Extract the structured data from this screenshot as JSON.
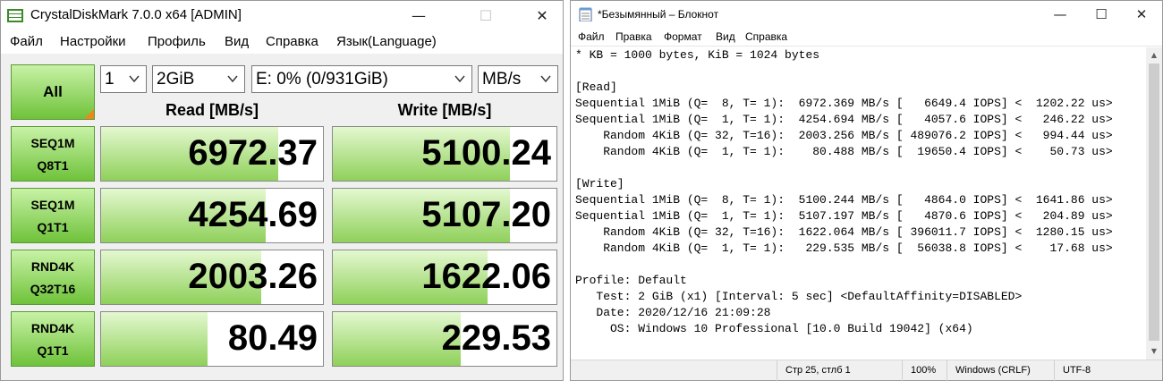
{
  "cdm": {
    "title": "CrystalDiskMark 7.0.0 x64 [ADMIN]",
    "menu": [
      "Файл",
      "Настройки",
      "Профиль",
      "Вид",
      "Справка",
      "Язык(Language)"
    ],
    "all_button": "All",
    "count": "1",
    "size": "2GiB",
    "drive": "E: 0% (0/931GiB)",
    "unit": "MB/s",
    "read_header": "Read [MB/s]",
    "write_header": "Write [MB/s]",
    "rows": [
      {
        "line1": "SEQ1M",
        "line2": "Q8T1",
        "read": "6972.37",
        "write": "5100.24",
        "read_fill": 0.8,
        "write_fill": 0.79
      },
      {
        "line1": "SEQ1M",
        "line2": "Q1T1",
        "read": "4254.69",
        "write": "5107.20",
        "read_fill": 0.74,
        "write_fill": 0.79
      },
      {
        "line1": "RND4K",
        "line2": "Q32T16",
        "read": "2003.26",
        "write": "1622.06",
        "read_fill": 0.72,
        "write_fill": 0.69
      },
      {
        "line1": "RND4K",
        "line2": "Q1T1",
        "read": "80.49",
        "write": "229.53",
        "read_fill": 0.48,
        "write_fill": 0.57
      }
    ]
  },
  "notepad": {
    "title": "*Безымянный – Блокнот",
    "menu": [
      "Файл",
      "Правка",
      "Формат",
      "Вид",
      "Справка"
    ],
    "lines": [
      "* KB = 1000 bytes, KiB = 1024 bytes",
      "",
      "[Read]",
      "Sequential 1MiB (Q=  8, T= 1):  6972.369 MB/s [   6649.4 IOPS] <  1202.22 us>",
      "Sequential 1MiB (Q=  1, T= 1):  4254.694 MB/s [   4057.6 IOPS] <   246.22 us>",
      "    Random 4KiB (Q= 32, T=16):  2003.256 MB/s [ 489076.2 IOPS] <   994.44 us>",
      "    Random 4KiB (Q=  1, T= 1):    80.488 MB/s [  19650.4 IOPS] <    50.73 us>",
      "",
      "[Write]",
      "Sequential 1MiB (Q=  8, T= 1):  5100.244 MB/s [   4864.0 IOPS] <  1641.86 us>",
      "Sequential 1MiB (Q=  1, T= 1):  5107.197 MB/s [   4870.6 IOPS] <   204.89 us>",
      "    Random 4KiB (Q= 32, T=16):  1622.064 MB/s [ 396011.7 IOPS] <  1280.15 us>",
      "    Random 4KiB (Q=  1, T= 1):   229.535 MB/s [  56038.8 IOPS] <    17.68 us>",
      "",
      "Profile: Default",
      "   Test: 2 GiB (x1) [Interval: 5 sec] <DefaultAffinity=DISABLED>",
      "   Date: 2020/12/16 21:09:28",
      "     OS: Windows 10 Professional [10.0 Build 19042] (x64)"
    ],
    "status": {
      "position": "Стр 25, стлб 1",
      "zoom": "100%",
      "eol": "Windows (CRLF)",
      "encoding": "UTF-8"
    }
  },
  "colors": {
    "label_green_top": "#c8f2a6",
    "label_green_bottom": "#6fc23a",
    "bar_green": "#8fd05a",
    "corner_orange": "#e8891c"
  }
}
